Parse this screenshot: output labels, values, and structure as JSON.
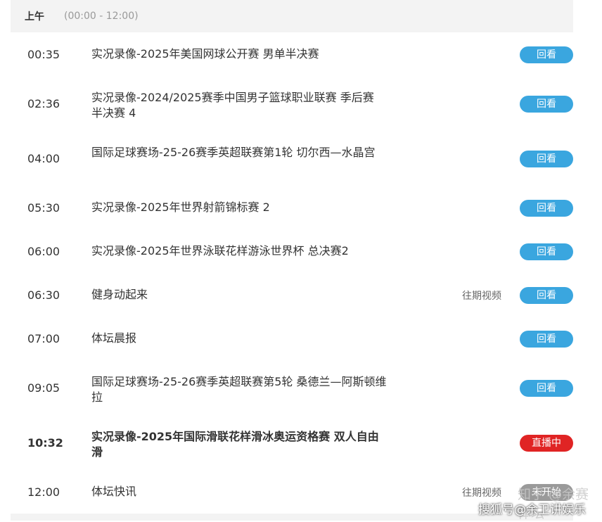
{
  "header": {
    "period": "上午",
    "range": "(00:00 - 12:00)"
  },
  "schedule": [
    {
      "time": "00:35",
      "title": "实况录像-2025年美国网球公开赛 男单半决赛",
      "aux": "",
      "button": "回看",
      "status": "replay"
    },
    {
      "time": "02:36",
      "title": "实况录像-2024/2025赛季中国男子篮球职业联赛 季后赛 半决赛 4",
      "aux": "",
      "button": "回看",
      "status": "replay"
    },
    {
      "time": "04:00",
      "title": "国际足球赛场-25-26赛季英超联赛第1轮 切尔西—水晶宫",
      "aux": "",
      "button": "回看",
      "status": "replay"
    },
    {
      "time": "05:30",
      "title": "实况录像-2025年世界射箭锦标赛 2",
      "aux": "",
      "button": "回看",
      "status": "replay"
    },
    {
      "time": "06:00",
      "title": "实况录像-2025年世界泳联花样游泳世界杯 总决赛2",
      "aux": "",
      "button": "回看",
      "status": "replay"
    },
    {
      "time": "06:30",
      "title": "健身动起来",
      "aux": "往期视频",
      "button": "回看",
      "status": "replay"
    },
    {
      "time": "07:00",
      "title": "体坛晨报",
      "aux": "",
      "button": "回看",
      "status": "replay"
    },
    {
      "time": "09:05",
      "title": "国际足球赛场-25-26赛季英超联赛第5轮 桑德兰—阿斯顿维拉",
      "aux": "",
      "button": "回看",
      "status": "replay"
    },
    {
      "time": "10:32",
      "title": "实况录像-2025年国际滑联花样滑冰奥运资格赛 双人自由滑",
      "aux": "",
      "button": "直播中",
      "status": "live"
    },
    {
      "time": "12:00",
      "title": "体坛快讯",
      "aux": "往期视频",
      "button": "未开始",
      "status": "upcoming"
    }
  ],
  "watermarks": {
    "zhihu": "知乎 @余赛体坛",
    "sohu": "搜狐号@余卫讲娱乐"
  },
  "colors": {
    "replay": "#3aa6df",
    "live": "#e02424",
    "upcoming": "#9a9a9a"
  }
}
